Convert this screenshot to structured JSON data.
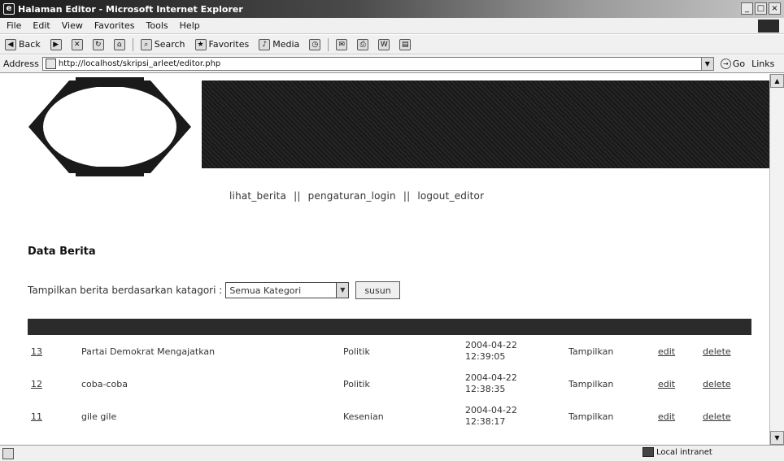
{
  "window": {
    "title": "Halaman Editor - Microsoft Internet Explorer",
    "minimize": "_",
    "maximize": "□",
    "close": "×"
  },
  "menu": [
    "File",
    "Edit",
    "View",
    "Favorites",
    "Tools",
    "Help"
  ],
  "toolbar": {
    "back": "Back",
    "search": "Search",
    "favorites": "Favorites",
    "media": "Media"
  },
  "address": {
    "label": "Address",
    "url": "http://localhost/skripsi_arleet/editor.php",
    "go": "Go",
    "links": "Links"
  },
  "nav": {
    "item1": "lihat_berita",
    "item2": "pengaturan_login",
    "item3": "logout_editor",
    "separator": "||"
  },
  "section_title": "Data Berita",
  "filter": {
    "label": "Tampilkan berita berdasarkan katagori :",
    "selected": "Semua Kategori",
    "button": "susun"
  },
  "table": {
    "rows": [
      {
        "id": "13",
        "judul": "Partai Demokrat Mengajatkan",
        "kategori": "Politik",
        "tanggal": "2004-04-22",
        "jam": "12:39:05",
        "status": "Tampilkan",
        "edit": "edit",
        "delete": "delete"
      },
      {
        "id": "12",
        "judul": "coba-coba",
        "kategori": "Politik",
        "tanggal": "2004-04-22",
        "jam": "12:38:35",
        "status": "Tampilkan",
        "edit": "edit",
        "delete": "delete"
      },
      {
        "id": "11",
        "judul": "gile gile",
        "kategori": "Kesenian",
        "tanggal": "2004-04-22",
        "jam": "12:38:17",
        "status": "Tampilkan",
        "edit": "edit",
        "delete": "delete"
      }
    ]
  },
  "status": {
    "zone": "Local intranet"
  },
  "colors": {
    "banner": "#1f1f1f",
    "table_header": "#2b2b2b"
  }
}
